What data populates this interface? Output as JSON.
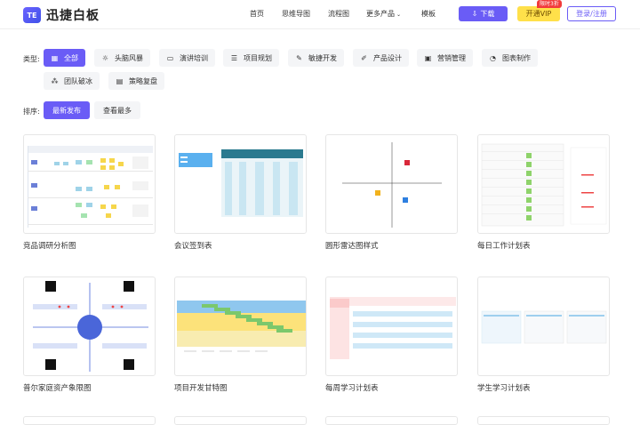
{
  "brand": {
    "logo_mark": "TE",
    "name": "迅捷白板"
  },
  "nav": {
    "home": "首页",
    "mindmap": "思维导图",
    "flowchart": "流程图",
    "more_products": "更多产品",
    "templates": "模板"
  },
  "header_actions": {
    "download": "下载",
    "vip": "开通VIP",
    "vip_badge": "限时3折",
    "login": "登录/注册"
  },
  "filters": {
    "type_label": "类型:",
    "types": [
      {
        "label": "全部",
        "icon": "grid-icon",
        "active": true
      },
      {
        "label": "头脑风暴",
        "icon": "bulb-icon",
        "active": false
      },
      {
        "label": "演讲培训",
        "icon": "presentation-icon",
        "active": false
      },
      {
        "label": "项目规划",
        "icon": "layers-icon",
        "active": false
      },
      {
        "label": "敏捷开发",
        "icon": "edit-icon",
        "active": false
      },
      {
        "label": "产品设计",
        "icon": "pen-icon",
        "active": false
      },
      {
        "label": "营销管理",
        "icon": "image-icon",
        "active": false
      },
      {
        "label": "图表制作",
        "icon": "pie-icon",
        "active": false
      },
      {
        "label": "团队破冰",
        "icon": "team-icon",
        "active": false
      },
      {
        "label": "策略复盘",
        "icon": "clipboard-icon",
        "active": false
      }
    ],
    "sort_label": "排序:",
    "sorts": [
      {
        "label": "最新发布",
        "active": true
      },
      {
        "label": "查看最多",
        "active": false
      }
    ]
  },
  "templates": [
    {
      "title": "竞品调研分析图"
    },
    {
      "title": "会议签到表"
    },
    {
      "title": "圆形雷达图样式"
    },
    {
      "title": "每日工作计划表"
    },
    {
      "title": "普尔家庭资产象限图"
    },
    {
      "title": "项目开发甘特图"
    },
    {
      "title": "每周学习计划表"
    },
    {
      "title": "学生学习计划表"
    }
  ],
  "colors": {
    "accent": "#6a5cf6",
    "vip": "#ffe04a",
    "badge": "#f23b3b",
    "chip_bg": "#f4f5f7"
  }
}
